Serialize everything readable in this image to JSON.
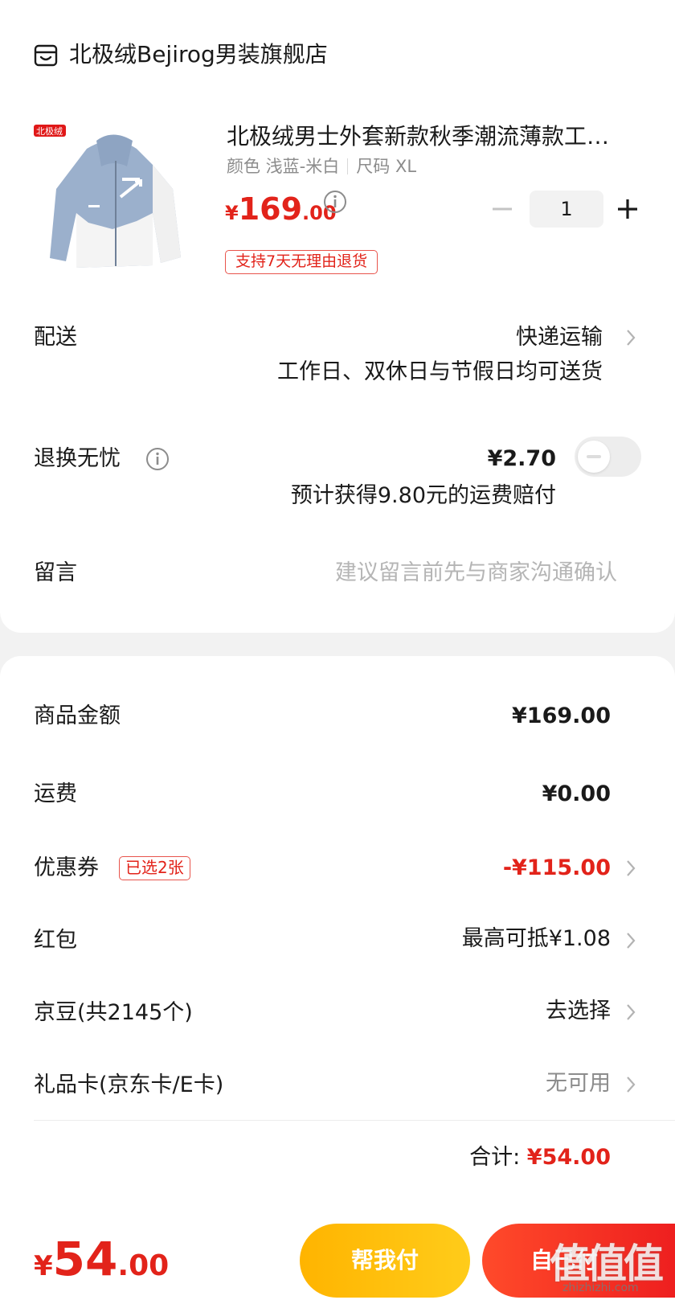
{
  "shop": {
    "name": "北极绒Bejirog男装旗舰店",
    "icon": "shop-icon"
  },
  "product": {
    "title": "北极绒男士外套新款秋季潮流薄款工…",
    "spec_color": "颜色 浅蓝-米白",
    "spec_size": "尺码 XL",
    "price_currency": "¥",
    "price_int": "169",
    "price_dec": ".00",
    "quantity": "1",
    "return_tag": "支持7天无理由退货",
    "image_logo": "北极绒"
  },
  "delivery": {
    "label": "配送",
    "method": "快递运输",
    "note": "工作日、双休日与节假日均可送货"
  },
  "return_insurance": {
    "label": "退换无忧",
    "price": "¥2.70",
    "note": "预计获得9.80元的运费赔付",
    "enabled": false
  },
  "message": {
    "label": "留言",
    "placeholder": "建议留言前先与商家沟通确认"
  },
  "summary": {
    "goods_label": "商品金额",
    "goods_value": "¥169.00",
    "shipping_label": "运费",
    "shipping_value": "¥0.00",
    "coupon_label": "优惠券",
    "coupon_tag": "已选2张",
    "coupon_value": "-¥115.00",
    "redpacket_label": "红包",
    "redpacket_value": "最高可抵¥1.08",
    "jingdou_label": "京豆(共2145个)",
    "jingdou_value": "去选择",
    "giftcard_label": "礼品卡(京东卡/E卡)",
    "giftcard_value": "无可用",
    "total_label": "合计:",
    "total_value": "¥54.00"
  },
  "bottom": {
    "total_currency": "¥",
    "total_int": "54",
    "total_dec": ".00",
    "help_pay_label": "帮我付",
    "self_pay_label": "自己付",
    "watermark": "值值值",
    "watermark_url": "zhizhizhi.com"
  },
  "colors": {
    "accent": "#e2231a",
    "help_btn": "#ffc000",
    "pay_btn": "#f42d21"
  }
}
